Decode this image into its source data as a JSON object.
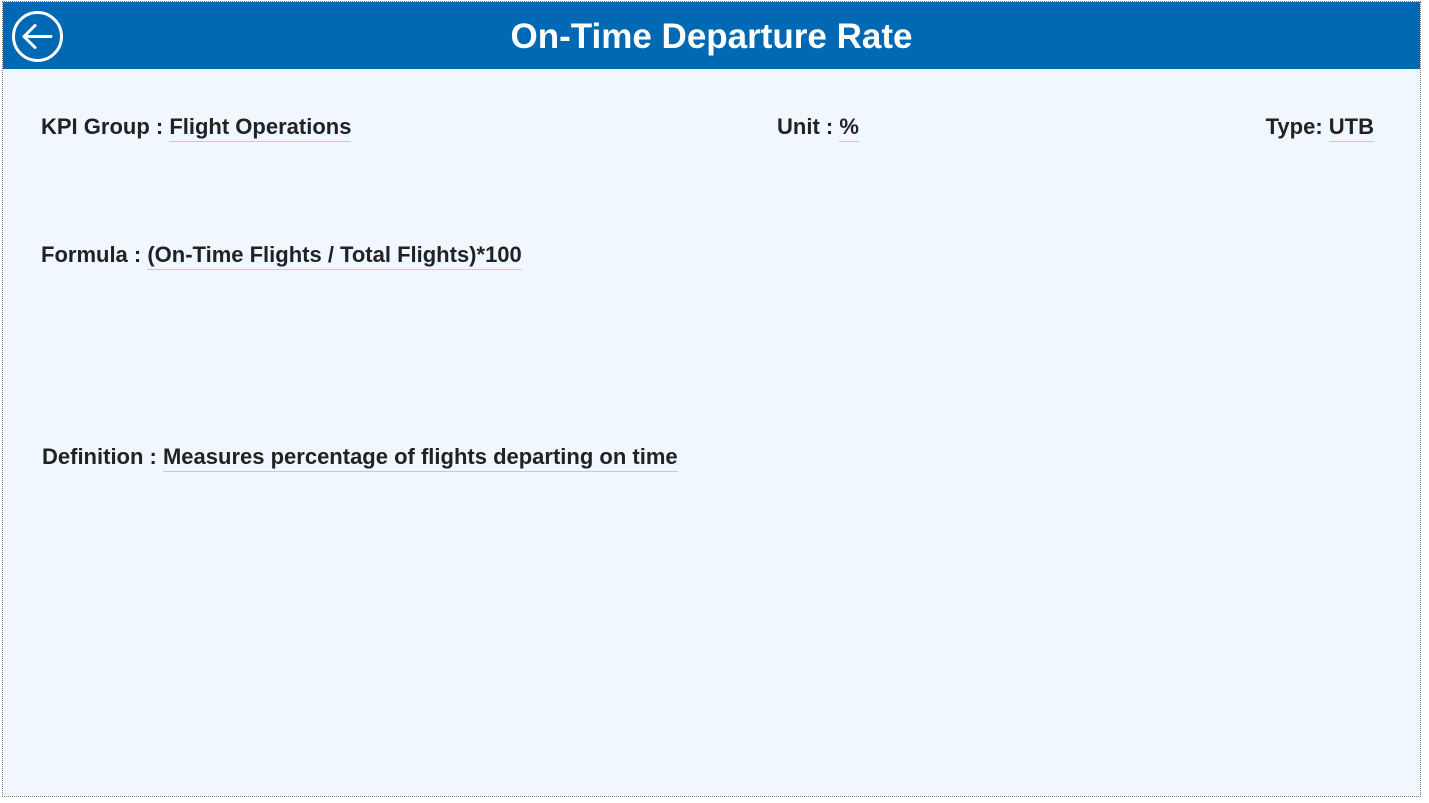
{
  "header": {
    "title": "On-Time Departure Rate",
    "back_icon": "circle-arrow-left-icon",
    "background": "#0168b3"
  },
  "fields": {
    "kpi_group": {
      "label": "KPI Group : ",
      "value": "Flight Operations"
    },
    "unit": {
      "label": "Unit : ",
      "value": "%"
    },
    "type": {
      "label": "Type: ",
      "value": "UTB"
    },
    "formula": {
      "label": "Formula : ",
      "value": "(On-Time Flights / Total Flights)*100"
    },
    "definition": {
      "label": "Definition : ",
      "value": "Measures percentage of flights departing on time"
    }
  },
  "colors": {
    "page_background": "#f0f7fe",
    "text": "#222222",
    "value_underline": "#a9d3f2"
  }
}
